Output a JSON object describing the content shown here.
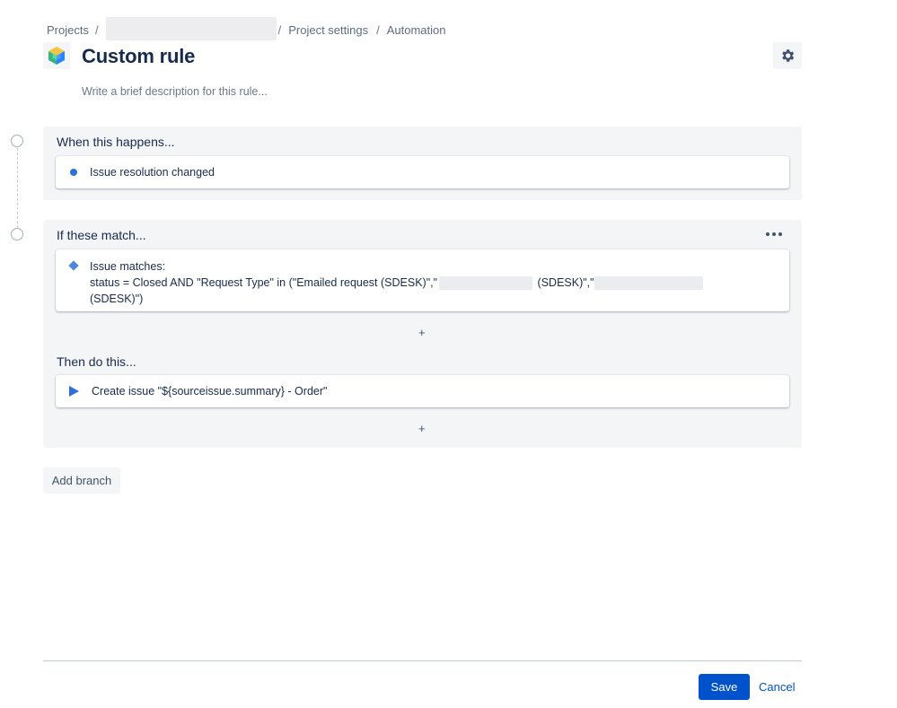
{
  "breadcrumb": {
    "projects": "Projects",
    "project_settings": "Project settings",
    "automation": "Automation",
    "separator": "/"
  },
  "header": {
    "title": "Custom rule",
    "description_placeholder": "Write a brief description for this rule..."
  },
  "trigger_section": {
    "title": "When this happens...",
    "trigger_label": "Issue resolution changed"
  },
  "condition_section": {
    "title": "If these match...",
    "condition_label": "Issue matches:",
    "jql_part1": "status = Closed AND \"Request Type\" in (\"Emailed request (SDESK)\",\"",
    "jql_part2": " (SDESK)\",\"",
    "jql_part3": "(SDESK)\")",
    "add_symbol": "+"
  },
  "action_section": {
    "title": "Then do this...",
    "action_label": "Create issue \"${sourceissue.summary} - Order\"",
    "add_symbol": "+"
  },
  "buttons": {
    "add_branch": "Add branch",
    "save": "Save",
    "cancel": "Cancel"
  },
  "colors": {
    "primary": "#0052cc",
    "panel_bg": "#f4f5f7",
    "text": "#172b4d",
    "trigger_dot": "#2f6fdb",
    "condition_diamond": "#4c86e0",
    "action_play": "#2f6fdb"
  },
  "icons": {
    "project_avatar": "cube-icon",
    "settings": "gear-icon",
    "trigger": "dot-icon",
    "condition": "diamond-icon",
    "action": "play-icon",
    "more": "more-horizontal-icon"
  }
}
